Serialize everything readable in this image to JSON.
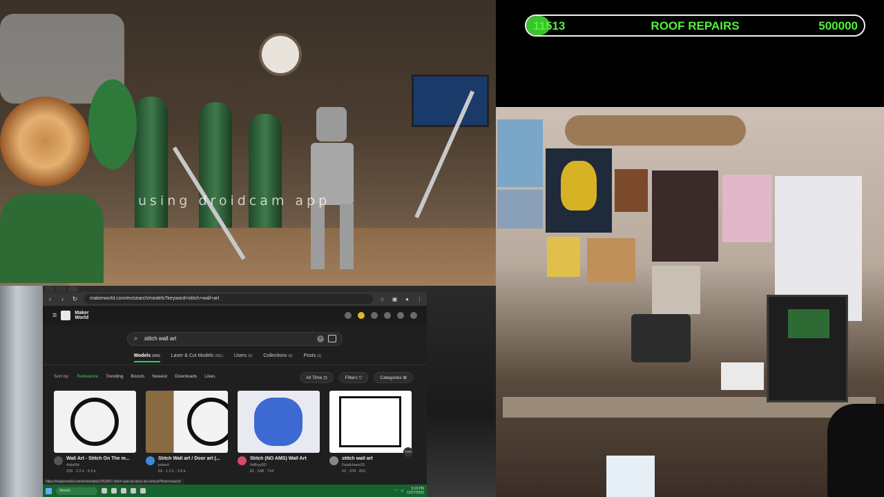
{
  "overlay": {
    "watermark": "using droidcam app",
    "goal": {
      "current": "11513",
      "title": "ROOF REPAIRS",
      "target": "500000",
      "progress": 0.023,
      "color": "#52f23a"
    }
  },
  "browser": {
    "url": "makerworld.com/en/search/models?keyword=stitch+wall+art",
    "site": {
      "logo_text": "Maker World"
    },
    "search": {
      "value": "stitch wall art"
    },
    "category_tabs": [
      {
        "label": "Models",
        "count": "(669)"
      },
      {
        "label": "Laser & Cut Models",
        "count": "(581)"
      },
      {
        "label": "Users",
        "count": "(0)"
      },
      {
        "label": "Collections",
        "count": "(0)"
      },
      {
        "label": "Posts",
        "count": "(2)"
      }
    ],
    "sort": {
      "label": "Sort by:",
      "options": [
        "Relevance",
        "Trending",
        "Boosts",
        "Newest",
        "Downloads",
        "Likes"
      ],
      "active": "Relevance"
    },
    "filters": {
      "time": "All Time",
      "filters": "Filters",
      "categories": "Categories"
    },
    "cards": [
      {
        "title": "Wall Art - Stitch On The m...",
        "author": "Artist3d",
        "stats": "239 · 2.2 k · 6.5 k"
      },
      {
        "title": "Stitch Wall art / Door art (...",
        "author": "jetasct",
        "stats": "63 · 1.2 k · 2.6 k"
      },
      {
        "title": "Stitch (NO AMS) Wall Art",
        "author": "ItsBryy3D",
        "stats": "81 · 548 · 718"
      },
      {
        "title": "stitch wall art",
        "author": "Fatalchaos25",
        "stats": "22 · 378 · 810"
      }
    ],
    "top_label": "TOP",
    "status_url": "https://makerworld.com/en/models/1352067-stitch-wall-art-door-art-vertical?from=search",
    "taskbar": {
      "search": "Search",
      "time": "9:19 PM",
      "date": "12/27/2025"
    }
  }
}
